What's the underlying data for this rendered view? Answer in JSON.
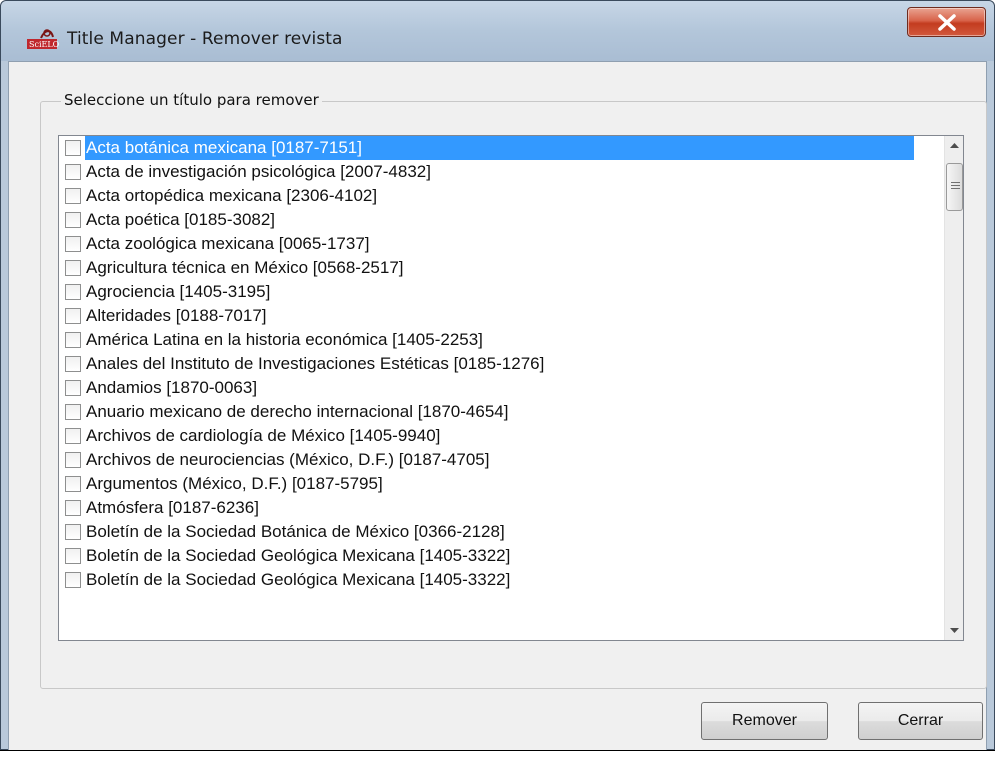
{
  "window": {
    "title": "Title Manager - Remover revista",
    "close_glyph": "✕",
    "app_icon": "scielo-logo-icon"
  },
  "group": {
    "legend": "Seleccione un título para remover"
  },
  "list": {
    "items": [
      {
        "label": "Acta botánica mexicana [0187-7151]",
        "checked": false,
        "selected": true
      },
      {
        "label": "Acta de investigación psicológica [2007-4832]",
        "checked": false,
        "selected": false
      },
      {
        "label": "Acta ortopédica mexicana [2306-4102]",
        "checked": false,
        "selected": false
      },
      {
        "label": "Acta poética [0185-3082]",
        "checked": false,
        "selected": false
      },
      {
        "label": "Acta zoológica mexicana [0065-1737]",
        "checked": false,
        "selected": false
      },
      {
        "label": "Agricultura técnica en México [0568-2517]",
        "checked": false,
        "selected": false
      },
      {
        "label": "Agrociencia [1405-3195]",
        "checked": false,
        "selected": false
      },
      {
        "label": "Alteridades [0188-7017]",
        "checked": false,
        "selected": false
      },
      {
        "label": "América Latina en la historia económica [1405-2253]",
        "checked": false,
        "selected": false
      },
      {
        "label": "Anales del Instituto de Investigaciones Estéticas [0185-1276]",
        "checked": false,
        "selected": false
      },
      {
        "label": "Andamios [1870-0063]",
        "checked": false,
        "selected": false
      },
      {
        "label": "Anuario mexicano de derecho internacional [1870-4654]",
        "checked": false,
        "selected": false
      },
      {
        "label": "Archivos de cardiología de México [1405-9940]",
        "checked": false,
        "selected": false
      },
      {
        "label": "Archivos de neurociencias (México, D.F.) [0187-4705]",
        "checked": false,
        "selected": false
      },
      {
        "label": "Argumentos (México, D.F.) [0187-5795]",
        "checked": false,
        "selected": false
      },
      {
        "label": "Atmósfera [0187-6236]",
        "checked": false,
        "selected": false
      },
      {
        "label": "Boletín de la Sociedad Botánica de México [0366-2128]",
        "checked": false,
        "selected": false
      },
      {
        "label": "Boletín de la Sociedad Geológica Mexicana [1405-3322]",
        "checked": false,
        "selected": false
      },
      {
        "label": "Boletín de la Sociedad Geológica Mexicana [1405-3322]",
        "checked": false,
        "selected": false
      }
    ]
  },
  "buttons": {
    "remove_label": "Remover",
    "close_label": "Cerrar"
  },
  "colors": {
    "selection": "#3399ff",
    "close_button": "#c94a2e",
    "title_bar": "#b9c9da"
  }
}
